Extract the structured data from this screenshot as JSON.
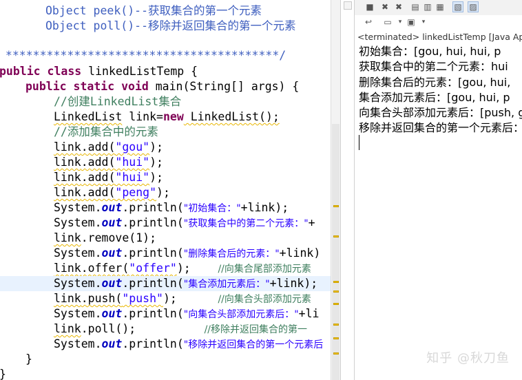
{
  "editor": {
    "doc_line1": "Object peek()--获取集合的第一个元素",
    "doc_line2": "Object poll()--移除并返回集合的第一个元素",
    "doc_end": " ****************************************/",
    "class_decl": {
      "kw": "public class",
      "name": " linkedListTemp {"
    },
    "main_decl": {
      "kw": "public static void",
      "rest": " main(String[] args) {"
    },
    "comment_create": "//创建LinkedList集合",
    "decl_line": {
      "type": "LinkedList",
      "mid": " link=",
      "kw": "new",
      "ctor": " LinkedList();"
    },
    "comment_add": "//添加集合中的元素",
    "add_calls": [
      {
        "recv": "link",
        "pre": ".add(",
        "str": "\"gou\"",
        "post": ");"
      },
      {
        "recv": "link",
        "pre": ".add(",
        "str": "\"hui\"",
        "post": ");"
      },
      {
        "recv": "link",
        "pre": ".add(",
        "str": "\"hui\"",
        "post": ");"
      },
      {
        "recv": "link",
        "pre": ".add(",
        "str": "\"peng\"",
        "post": ");"
      }
    ],
    "println1": {
      "pre": "System.",
      "out": "out",
      "mid": ".println(",
      "str": "\"初始集合：\"",
      "post": "+link);"
    },
    "println2": {
      "pre": "System.",
      "out": "out",
      "mid": ".println(",
      "str": "\"获取集合中的第二个元素：\"",
      "post": "+"
    },
    "remove_line": {
      "recv": "link",
      "rest": ".remove(1);"
    },
    "println3": {
      "pre": "System.",
      "out": "out",
      "mid": ".println(",
      "str": "\"删除集合后的元素：\"",
      "post": "+link)"
    },
    "offer_line": {
      "recv": "link",
      "pre": ".offer(",
      "str": "\"offer\"",
      "post": ");    ",
      "comment": "//向集合尾部添加元素"
    },
    "println4": {
      "pre": "System.",
      "out": "out",
      "mid": ".println(",
      "str": "\"集合添加元素后：\"",
      "post": "+link);"
    },
    "push_line": {
      "recv": "link",
      "pre": ".push(",
      "str": "\"push\"",
      "post": ");      ",
      "comment": "//向集合头部添加元素"
    },
    "println5": {
      "pre": "System.",
      "out": "out",
      "mid": ".println(",
      "str": "\"向集合头部添加元素后：\"",
      "post": "+li"
    },
    "poll_line": {
      "recv": "link",
      "rest": ".poll();          ",
      "comment": "//移除并返回集合的第一"
    },
    "println6": {
      "pre": "System.",
      "out": "out",
      "mid": ".println(",
      "str": "\"移除并返回集合的第一个元素后"
    },
    "close_method": "}",
    "close_class": "}"
  },
  "console": {
    "terminated_label": "<terminated> linkedListTemp [Java Appli",
    "output_lines": [
      "初始集合：[gou, hui, hui, p",
      "获取集合中的第二个元素：hui",
      "删除集合后的元素：[gou, hui,",
      "集合添加元素后：[gou, hui, p",
      "向集合头部添加元素后：[push, g",
      "移除并返回集合的第一个元素后：[g"
    ]
  },
  "watermark": "知乎 @秋刀鱼",
  "colors": {
    "keyword": "#7f0055",
    "comment": "#3f7f5f",
    "javadoc": "#3f5fbf",
    "string": "#2a00ff",
    "field": "#0000c0",
    "current_line": "#e8f2fe"
  }
}
